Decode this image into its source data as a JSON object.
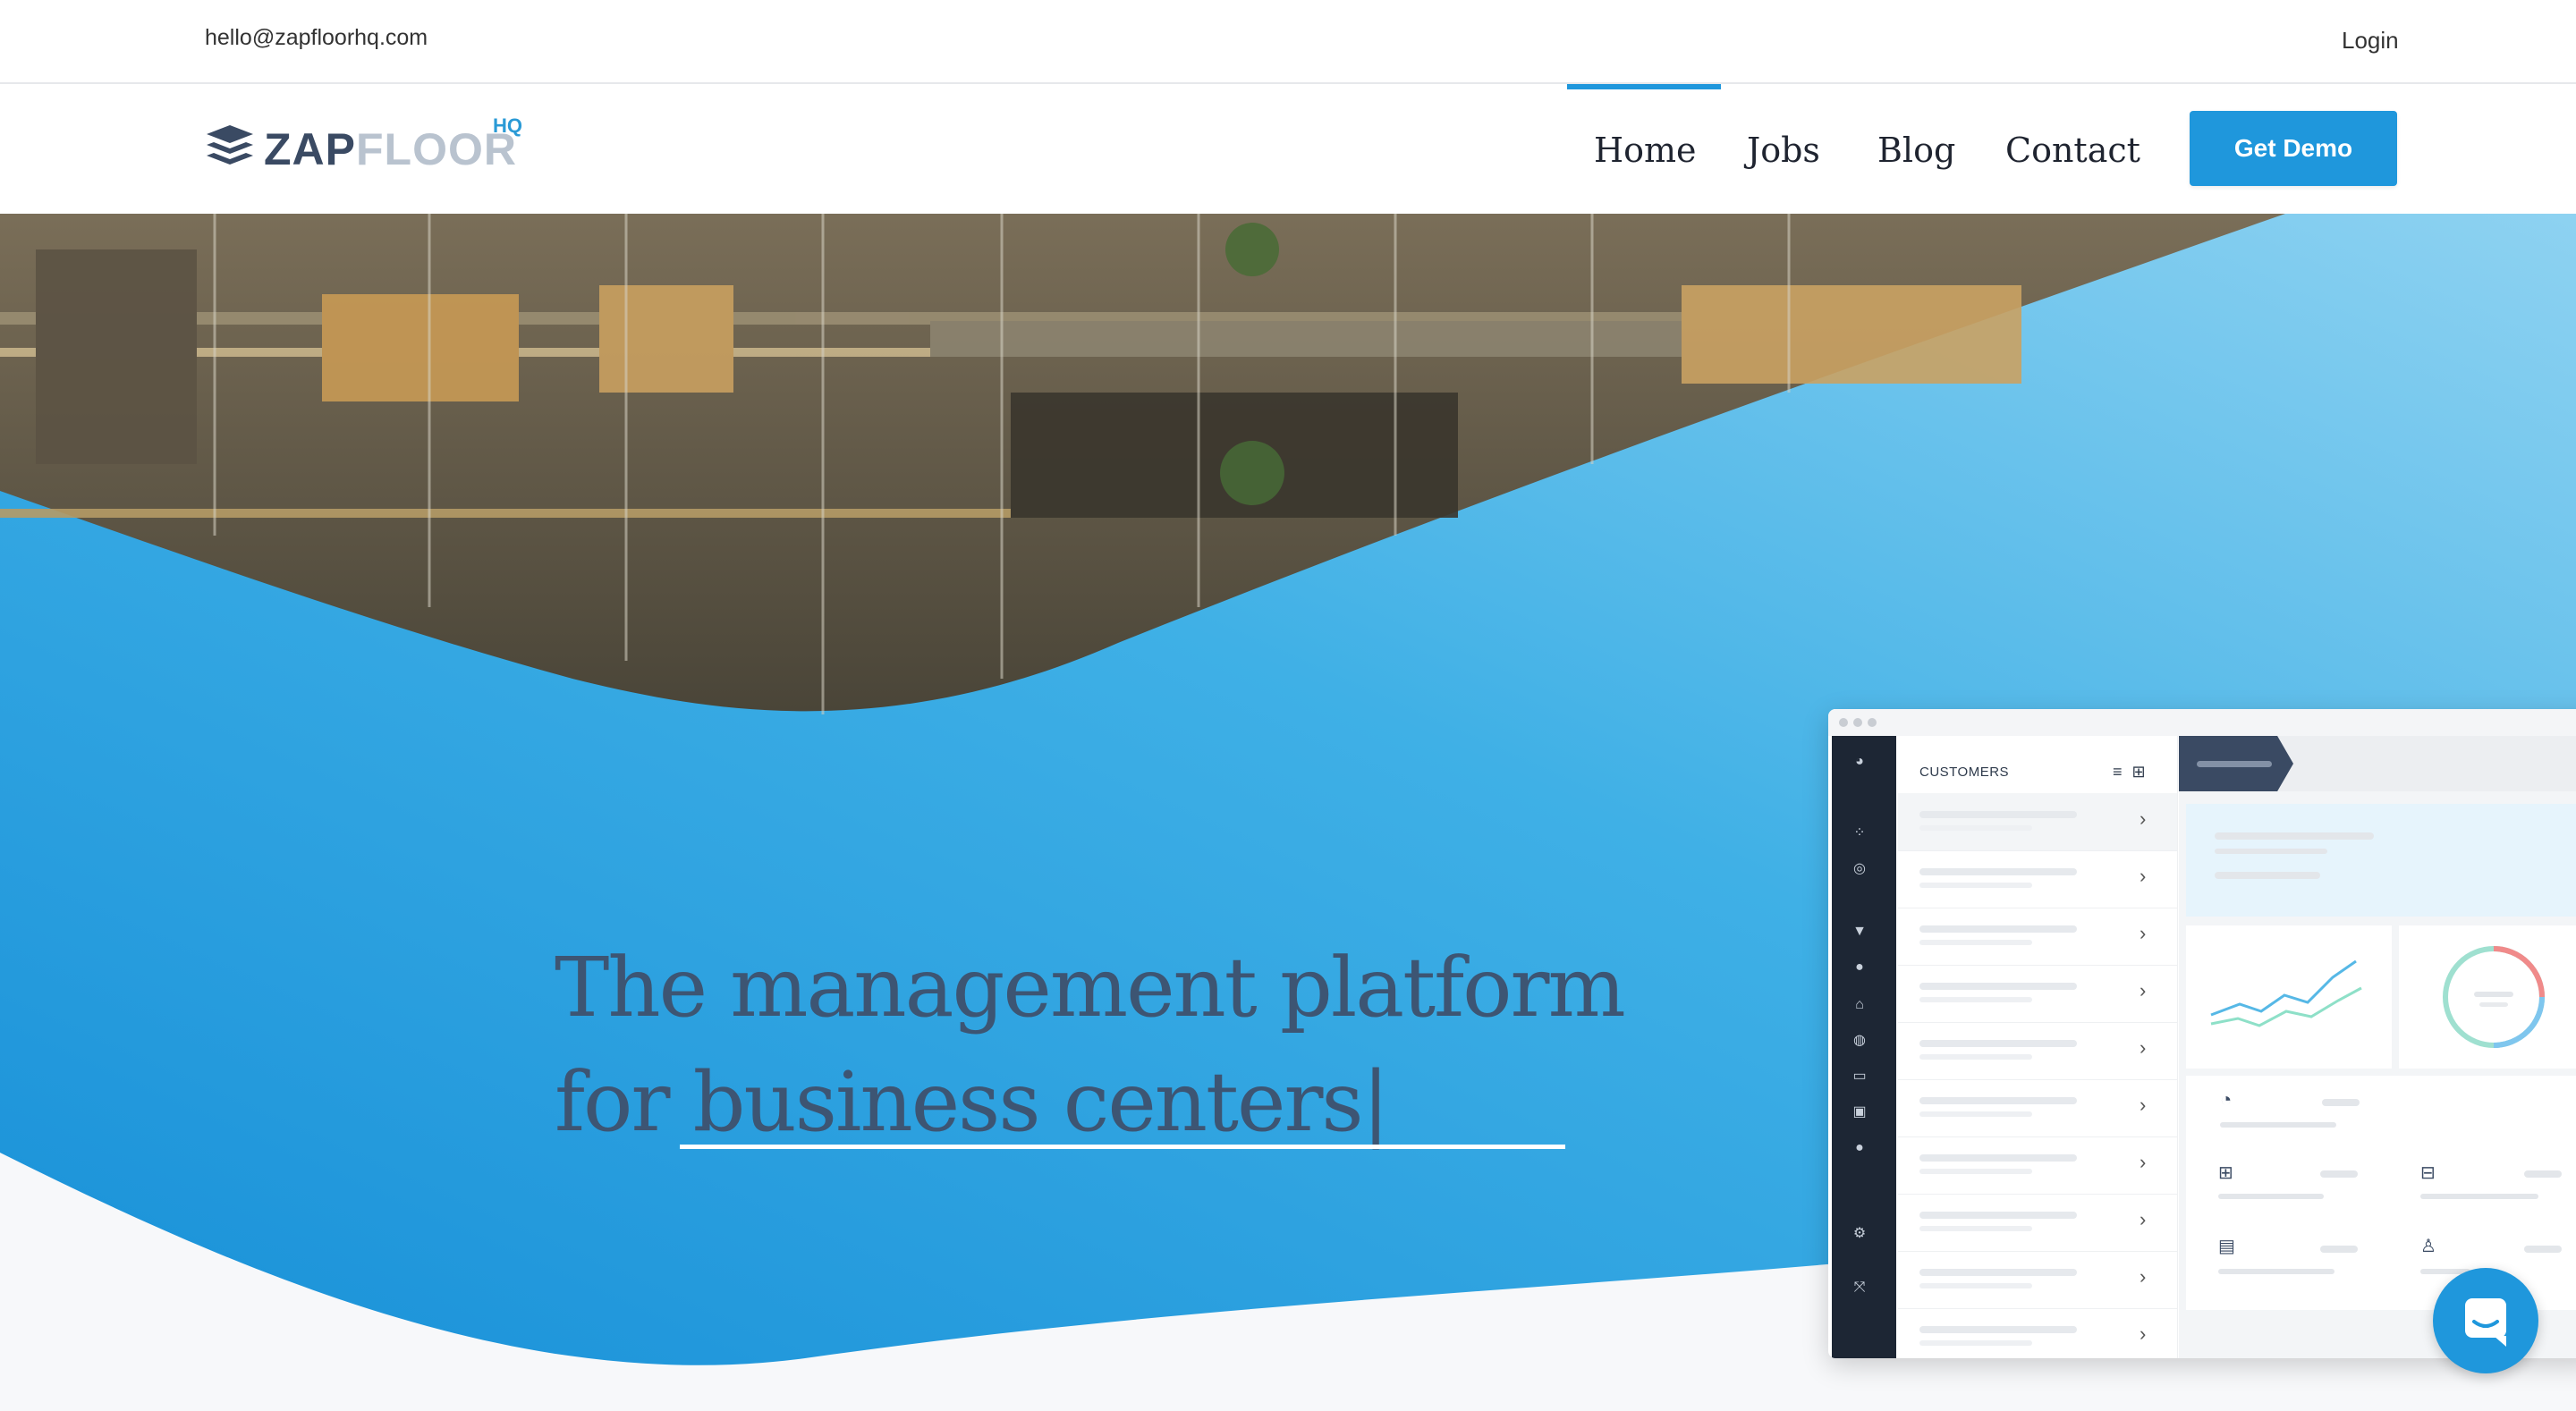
{
  "topbar": {
    "email": "hello@zapfloorhq.com",
    "login": "Login"
  },
  "logo": {
    "zap": "ZAP",
    "floor": "FLOOR",
    "hq": "HQ"
  },
  "nav": {
    "items": [
      {
        "label": "Home",
        "active": true
      },
      {
        "label": "Jobs",
        "active": false
      },
      {
        "label": "Blog",
        "active": false
      },
      {
        "label": "Contact",
        "active": false
      }
    ],
    "cta": "Get Demo"
  },
  "hero": {
    "line1": "The management platform",
    "line2": "for business centers|"
  },
  "mockup": {
    "list_header": "CUSTOMERS",
    "row_count": 10
  },
  "colors": {
    "accent": "#1f97dc",
    "navy": "#3d5573",
    "sidebar": "#1d2634"
  },
  "icons": [
    "envelope-free",
    "logo-stack-icon",
    "filter-icon",
    "add-icon",
    "chevron-right-icon",
    "chat-icon"
  ]
}
